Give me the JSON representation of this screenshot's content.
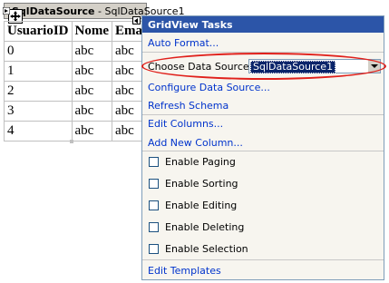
{
  "sqldatasource": {
    "type": "SqlDataSource",
    "name": "SqlDataSource1"
  },
  "grid": {
    "columns": [
      "UsuarioID",
      "Nome",
      "Email"
    ],
    "rows": [
      [
        "0",
        "abc",
        "abc"
      ],
      [
        "1",
        "abc",
        "abc"
      ],
      [
        "2",
        "abc",
        "abc"
      ],
      [
        "3",
        "abc",
        "abc"
      ],
      [
        "4",
        "abc",
        "abc"
      ]
    ]
  },
  "tasks": {
    "title": "GridView Tasks",
    "auto_format": "Auto Format...",
    "choose_ds_label": "Choose Data Source:",
    "choose_ds_value": "SqlDataSource1",
    "configure_ds": "Configure Data Source...",
    "refresh_schema": "Refresh Schema",
    "edit_columns": "Edit Columns...",
    "add_new_column": "Add New Column...",
    "checkboxes": [
      {
        "label": "Enable Paging",
        "checked": false
      },
      {
        "label": "Enable Sorting",
        "checked": false
      },
      {
        "label": "Enable Editing",
        "checked": false
      },
      {
        "label": "Enable Deleting",
        "checked": false
      },
      {
        "label": "Enable Selection",
        "checked": false
      }
    ],
    "edit_templates": "Edit Templates"
  },
  "colors": {
    "header_bg": "#2c55a8",
    "link": "#0033cc",
    "highlight": "#e0201b"
  }
}
